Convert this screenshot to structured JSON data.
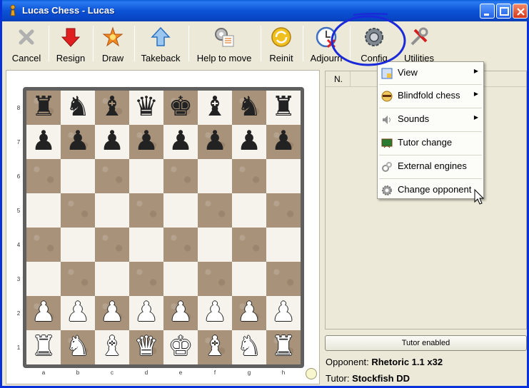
{
  "window": {
    "title": "Lucas Chess - Lucas"
  },
  "toolbar": [
    {
      "label": "Cancel",
      "icon": "cancel-icon"
    },
    {
      "label": "Resign",
      "icon": "resign-icon"
    },
    {
      "label": "Draw",
      "icon": "draw-icon"
    },
    {
      "label": "Takeback",
      "icon": "takeback-icon"
    },
    {
      "label": "Help to move",
      "icon": "help-to-move-icon"
    },
    {
      "label": "Reinit",
      "icon": "reinit-icon"
    },
    {
      "label": "Adjourn",
      "icon": "adjourn-icon"
    },
    {
      "label": "Config",
      "icon": "config-icon"
    },
    {
      "label": "Utilities",
      "icon": "utilities-icon"
    }
  ],
  "board": {
    "ranks": [
      "8",
      "7",
      "6",
      "5",
      "4",
      "3",
      "2",
      "1"
    ],
    "files": [
      "a",
      "b",
      "c",
      "d",
      "e",
      "f",
      "g",
      "h"
    ],
    "position": [
      "rnbqkbnr",
      "pppppppp",
      "........",
      "........",
      "........",
      "........",
      "PPPPPPPP",
      "RNBQKBNR"
    ]
  },
  "moves": {
    "column_n": "N."
  },
  "config_menu": [
    {
      "label": "View",
      "icon": "view-icon",
      "submenu": true
    },
    {
      "label": "Blindfold chess",
      "icon": "blindfold-icon",
      "submenu": true
    },
    {
      "label": "Sounds",
      "icon": "sound-icon",
      "submenu": true
    },
    {
      "label": "Tutor change",
      "icon": "tutor-icon",
      "submenu": false
    },
    {
      "label": "External engines",
      "icon": "engines-icon",
      "submenu": false
    },
    {
      "label": "Change opponent",
      "icon": "gear-icon",
      "submenu": false
    }
  ],
  "tutor_button": "Tutor enabled",
  "opponent": {
    "label": "Opponent:",
    "value": "Rhetoric 1.1 x32"
  },
  "tutor": {
    "label": "Tutor:",
    "value": "Stockfish DD"
  },
  "colors": {
    "titlebar": "#0a53d6",
    "annotation": "#1a2ad8",
    "dark_square": "#a8927a",
    "light_square": "#f6f3ec"
  }
}
